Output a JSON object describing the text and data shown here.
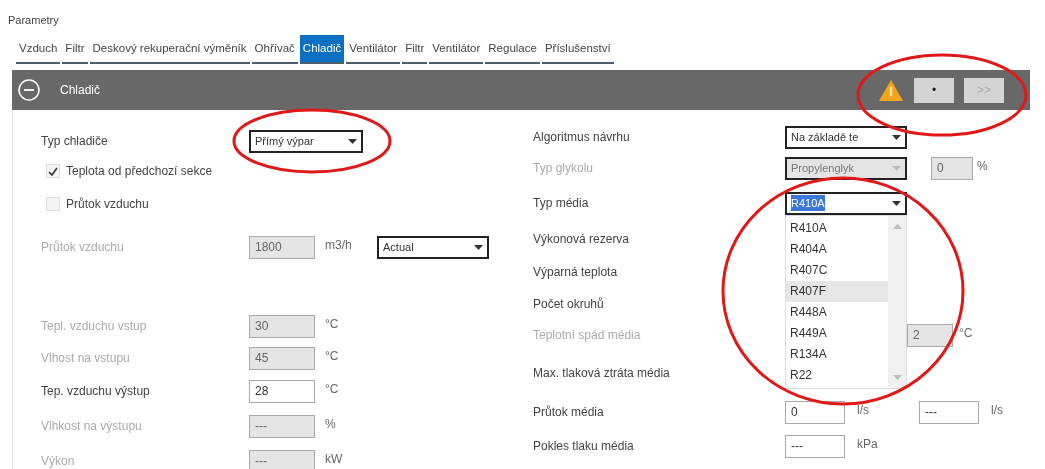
{
  "panel_label": "Parametry",
  "tabs": [
    {
      "label": "Vzduch",
      "selected": false
    },
    {
      "label": "Filtr",
      "selected": false
    },
    {
      "label": "Deskový rekuperační výměník",
      "selected": false
    },
    {
      "label": "Ohřívač",
      "selected": false
    },
    {
      "label": "Chladič",
      "selected": true
    },
    {
      "label": "Ventilátor",
      "selected": false
    },
    {
      "label": "Filtr",
      "selected": false
    },
    {
      "label": "Ventilátor",
      "selected": false
    },
    {
      "label": "Regulace",
      "selected": false
    },
    {
      "label": "Příslušenství",
      "selected": false
    }
  ],
  "section": {
    "title": "Chladič",
    "expanded": true,
    "warning": true,
    "buttons": [
      {
        "label": "•",
        "disabled": false
      },
      {
        "label": ">>",
        "disabled": true
      }
    ]
  },
  "left_groups": [
    [
      {
        "kind": "select",
        "label": "Typ chladiče",
        "value": "Přímý výpar",
        "disabled": false
      },
      {
        "kind": "checkbox",
        "label": "Teplota od předchozí sekce",
        "checked": true
      },
      {
        "kind": "checkbox",
        "label": "Průtok vzduchu",
        "checked": false
      },
      {
        "kind": "input",
        "label": "Průtok vzduchu",
        "value": "1800",
        "unit": "m3/h",
        "disabled": true,
        "select": {
          "value": "Actual"
        }
      }
    ],
    [
      {
        "kind": "input",
        "label": "Tepl. vzduchu vstup",
        "value": "30",
        "unit": "°C",
        "disabled": true
      },
      {
        "kind": "input",
        "label": "Vlhost na vstupu",
        "value": "45",
        "unit": "°C",
        "disabled": true
      },
      {
        "kind": "input",
        "label": "Tep. vzduchu výstup",
        "value": "28",
        "unit": "°C",
        "disabled": false
      },
      {
        "kind": "input",
        "label": "Vlhkost na výstupu",
        "value": "---",
        "unit": "%",
        "disabled": true
      },
      {
        "kind": "input",
        "label": "Výkon",
        "value": "---",
        "unit": "kW",
        "disabled": true
      }
    ]
  ],
  "right_rows": [
    {
      "kind": "select",
      "label": "Algoritmus návrhu",
      "value": "Na základě te",
      "disabled": false
    },
    {
      "kind": "select",
      "label": "Typ glykolu",
      "value": "Propylenglyk",
      "disabled": true,
      "extra": {
        "value": "0",
        "unit": "%"
      }
    },
    {
      "kind": "select",
      "label": "Typ média",
      "value": "R410A",
      "disabled": false,
      "open": true,
      "options": [
        {
          "label": "R410A",
          "highlighted": false
        },
        {
          "label": "R404A",
          "highlighted": false
        },
        {
          "label": "R407C",
          "highlighted": false
        },
        {
          "label": "R407F",
          "highlighted": true
        },
        {
          "label": "R448A",
          "highlighted": false
        },
        {
          "label": "R449A",
          "highlighted": false
        },
        {
          "label": "R134A",
          "highlighted": false
        },
        {
          "label": "R22",
          "highlighted": false
        }
      ]
    },
    {
      "kind": "label",
      "label": "Výkonová rezerva",
      "disabled": false
    },
    {
      "kind": "label",
      "label": "Výparná teplota",
      "disabled": false
    },
    {
      "kind": "label",
      "label": "Počet okruhů",
      "disabled": false
    },
    {
      "kind": "second_input",
      "label": "Teplotní spád média",
      "value": "2",
      "unit": "°C",
      "disabled": true
    },
    {
      "kind": "label",
      "label": "Max. tlaková ztráta média",
      "disabled": false
    },
    {
      "kind": "input",
      "label": "Průtok média",
      "value": "0",
      "unit": "l/s",
      "disabled": false,
      "extra": {
        "value": "---",
        "unit": "l/s"
      }
    },
    {
      "kind": "input",
      "label": "Pokles tlaku média",
      "value": "---",
      "unit": "kPa",
      "disabled": false
    }
  ]
}
